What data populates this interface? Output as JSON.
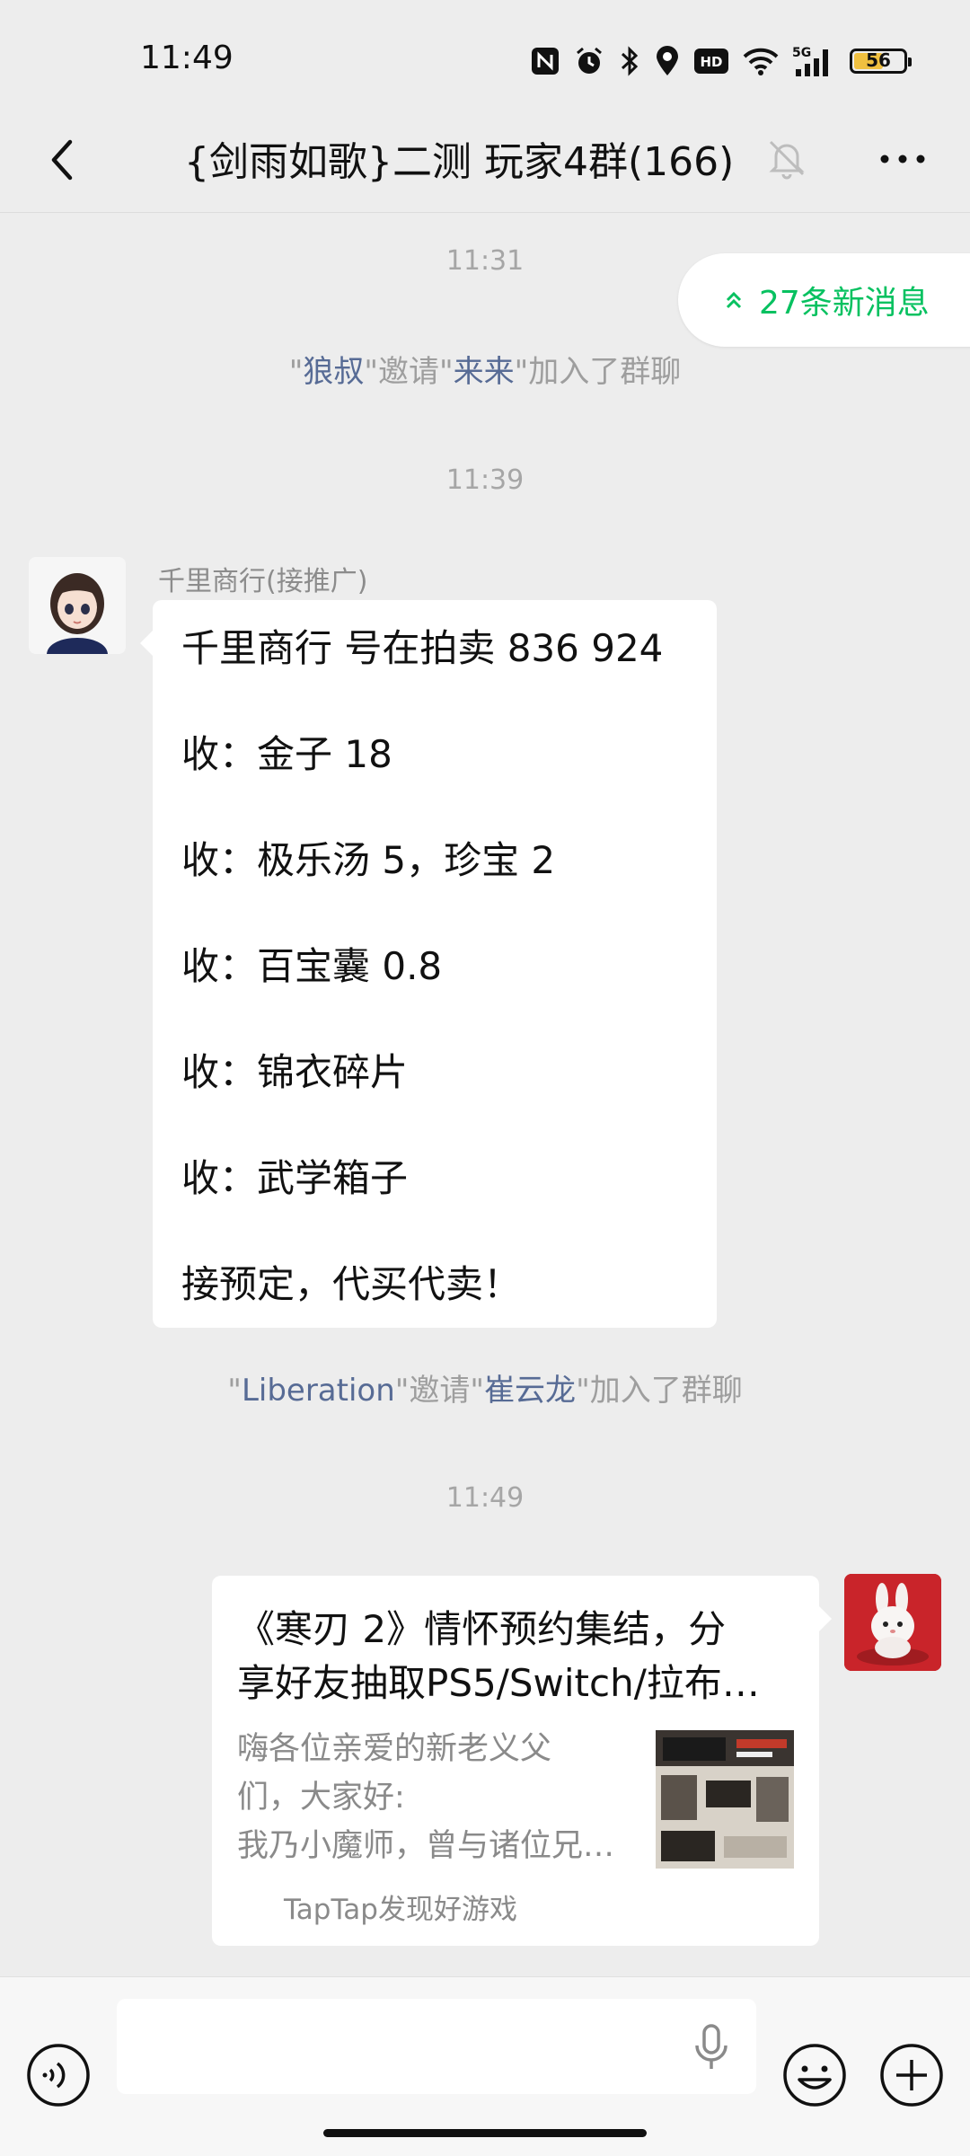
{
  "status_bar": {
    "time": "11:49",
    "battery_level": "56",
    "battery_fraction": 0.56,
    "icons": [
      "nfc-icon",
      "alarm-icon",
      "bluetooth-icon",
      "location-icon",
      "hd-icon",
      "wifi-icon",
      "signal-5g-icon",
      "battery-icon"
    ]
  },
  "header": {
    "title": "{剑雨如歌}二测 玩家4群(166)",
    "back_icon": "chevron-left-icon",
    "mute_icon": "bell-off-icon",
    "more_icon": "more-dots-icon"
  },
  "new_messages_pill": {
    "label": "27条新消息",
    "color": "#07c160"
  },
  "messages": {
    "time1": "11:31",
    "sys1": {
      "q1": "\"",
      "inviter": "狼叔",
      "mid": "\"邀请\"",
      "invitee": "来来",
      "tail": "\"加入了群聊"
    },
    "time2": "11:39",
    "msg1": {
      "sender": "千里商行(接推广)",
      "lines": [
        "千里商行  号在拍卖 836 924",
        "收：金子 18",
        "收：极乐汤 5，珍宝 2",
        "收：百宝囊 0.8",
        "收：锦衣碎片",
        "收：武学箱子",
        "接预定，代买代卖！"
      ]
    },
    "sys2": {
      "q1": "\"",
      "inviter": "Liberation",
      "mid": "\"邀请\"",
      "invitee": "崔云龙",
      "tail": "\"加入了群聊"
    },
    "time3": "11:49",
    "card": {
      "title_line1": "《寒刃 2》情怀预约集结，分",
      "title_line2": "享好友抽取PS5/Switch/拉布…",
      "desc_line1": "嗨各位亲爱的新老义父",
      "desc_line2": "们，大家好:",
      "desc_line3": "我乃小魔师，曾与诸位兄…",
      "source": "TapTap发现好游戏"
    }
  },
  "input_bar": {
    "voice_icon": "voice-icon",
    "mic_icon": "microphone-icon",
    "emoji_icon": "emoji-icon",
    "plus_icon": "plus-icon"
  },
  "colors": {
    "link": "#576b95",
    "background": "#ededed",
    "bubble": "#ffffff",
    "accent_green": "#07c160"
  }
}
